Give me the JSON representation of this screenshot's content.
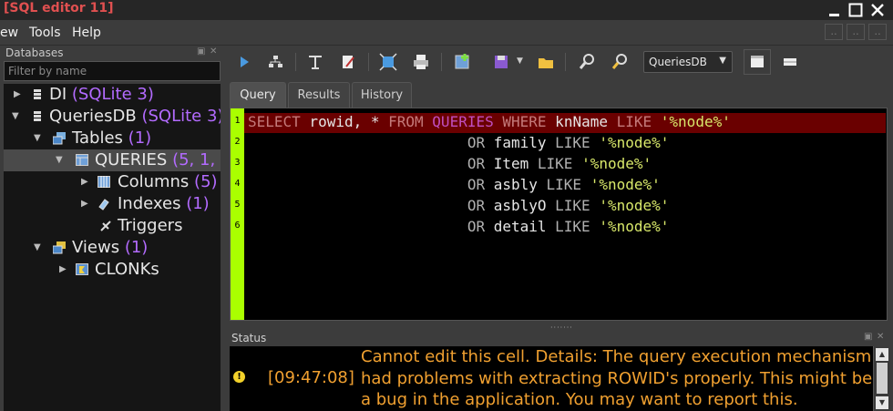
{
  "window": {
    "title": "[SQL editor 11]"
  },
  "menu": {
    "items": [
      "ew",
      "Tools",
      "Help"
    ]
  },
  "databases_panel": {
    "title": "Databases",
    "filter_placeholder": "Filter by name",
    "tree": [
      {
        "label": "DI",
        "count": "(SQLite 3)"
      },
      {
        "label": "QueriesDB",
        "count": "(SQLite 3)"
      },
      {
        "label": "Tables",
        "count": "(1)"
      },
      {
        "label": "QUERIES",
        "count": "(5, 1,"
      },
      {
        "label": "Columns",
        "count": "(5)"
      },
      {
        "label": "Indexes",
        "count": "(1)"
      },
      {
        "label": "Triggers",
        "count": ""
      },
      {
        "label": "Views",
        "count": "(1)"
      },
      {
        "label": "CLONKs",
        "count": ""
      }
    ]
  },
  "toolbar": {
    "database_selected": "QueriesDB"
  },
  "tabs": [
    {
      "label": "Query",
      "active": true
    },
    {
      "label": "Results",
      "active": false
    },
    {
      "label": "History",
      "active": false
    }
  ],
  "editor": {
    "line_numbers": [
      "1",
      "2",
      "3",
      "4",
      "5",
      "6"
    ],
    "lines": [
      "SELECT rowid, * FROM QUERIES WHERE knName LIKE '%node%'",
      "                         OR family LIKE '%node%'",
      "                         OR Item LIKE '%node%'",
      "                         OR asbly LIKE '%node%'",
      "                         OR asblyO LIKE '%node%'",
      "                         OR detail LIKE '%node%'"
    ]
  },
  "status": {
    "title": "Status",
    "time": "[09:47:08]",
    "message": "Cannot edit this cell. Details: The query execution mechanism had problems with extracting ROWID's properly. This might be a bug in the application. You may want to report this."
  },
  "colors": {
    "accent_count": "#b36bff",
    "gutter": "#aaff00",
    "current_line": "#6a0000",
    "status_text": "#f0a030",
    "title_text": "#e05050"
  }
}
